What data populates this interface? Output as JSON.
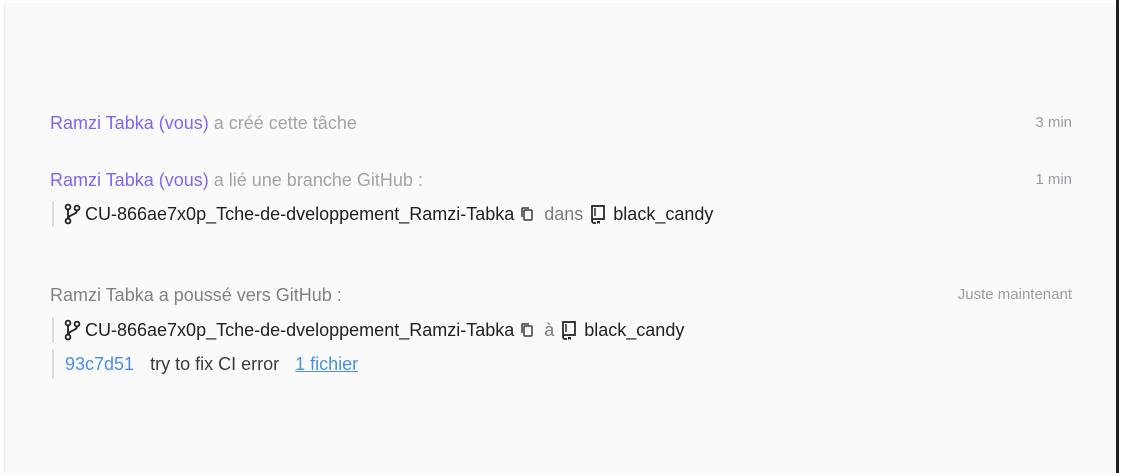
{
  "activity": [
    {
      "user": "Ramzi Tabka (vous)",
      "action": "a créé cette tâche",
      "time": "3 min"
    },
    {
      "user": "Ramzi Tabka (vous)",
      "action": "a lié une branche GitHub :",
      "time": "1 min",
      "branch": "CU-866ae7x0p_Tche-de-dveloppement_Ramzi-Tabka",
      "connector": "dans",
      "repo": "black_candy"
    },
    {
      "actor": "Ramzi Tabka a poussé vers GitHub :",
      "time": "Juste maintenant",
      "branch": "CU-866ae7x0p_Tche-de-dveloppement_Ramzi-Tabka",
      "connector": "à",
      "repo": "black_candy",
      "commit": {
        "hash": "93c7d51",
        "message": "try to fix CI error",
        "files": "1 fichier"
      }
    }
  ],
  "colors": {
    "user": "#7b68ee",
    "link": "#4a90e2",
    "muted": "#a3a3aa"
  },
  "icons": [
    "git-branch-icon",
    "copy-icon",
    "repo-icon"
  ]
}
